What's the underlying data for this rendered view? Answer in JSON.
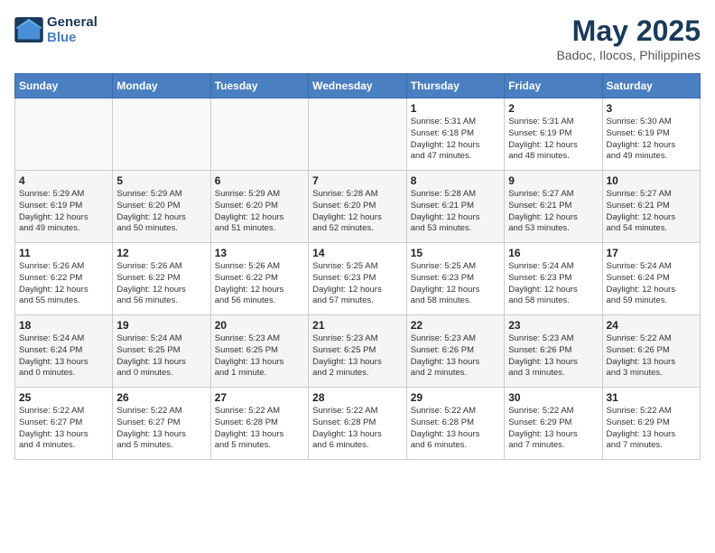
{
  "header": {
    "logo_line1": "General",
    "logo_line2": "Blue",
    "month": "May 2025",
    "location": "Badoc, Ilocos, Philippines"
  },
  "weekdays": [
    "Sunday",
    "Monday",
    "Tuesday",
    "Wednesday",
    "Thursday",
    "Friday",
    "Saturday"
  ],
  "weeks": [
    [
      {
        "day": "",
        "info": ""
      },
      {
        "day": "",
        "info": ""
      },
      {
        "day": "",
        "info": ""
      },
      {
        "day": "",
        "info": ""
      },
      {
        "day": "1",
        "info": "Sunrise: 5:31 AM\nSunset: 6:18 PM\nDaylight: 12 hours\nand 47 minutes."
      },
      {
        "day": "2",
        "info": "Sunrise: 5:31 AM\nSunset: 6:19 PM\nDaylight: 12 hours\nand 48 minutes."
      },
      {
        "day": "3",
        "info": "Sunrise: 5:30 AM\nSunset: 6:19 PM\nDaylight: 12 hours\nand 49 minutes."
      }
    ],
    [
      {
        "day": "4",
        "info": "Sunrise: 5:29 AM\nSunset: 6:19 PM\nDaylight: 12 hours\nand 49 minutes."
      },
      {
        "day": "5",
        "info": "Sunrise: 5:29 AM\nSunset: 6:20 PM\nDaylight: 12 hours\nand 50 minutes."
      },
      {
        "day": "6",
        "info": "Sunrise: 5:29 AM\nSunset: 6:20 PM\nDaylight: 12 hours\nand 51 minutes."
      },
      {
        "day": "7",
        "info": "Sunrise: 5:28 AM\nSunset: 6:20 PM\nDaylight: 12 hours\nand 52 minutes."
      },
      {
        "day": "8",
        "info": "Sunrise: 5:28 AM\nSunset: 6:21 PM\nDaylight: 12 hours\nand 53 minutes."
      },
      {
        "day": "9",
        "info": "Sunrise: 5:27 AM\nSunset: 6:21 PM\nDaylight: 12 hours\nand 53 minutes."
      },
      {
        "day": "10",
        "info": "Sunrise: 5:27 AM\nSunset: 6:21 PM\nDaylight: 12 hours\nand 54 minutes."
      }
    ],
    [
      {
        "day": "11",
        "info": "Sunrise: 5:26 AM\nSunset: 6:22 PM\nDaylight: 12 hours\nand 55 minutes."
      },
      {
        "day": "12",
        "info": "Sunrise: 5:26 AM\nSunset: 6:22 PM\nDaylight: 12 hours\nand 56 minutes."
      },
      {
        "day": "13",
        "info": "Sunrise: 5:26 AM\nSunset: 6:22 PM\nDaylight: 12 hours\nand 56 minutes."
      },
      {
        "day": "14",
        "info": "Sunrise: 5:25 AM\nSunset: 6:23 PM\nDaylight: 12 hours\nand 57 minutes."
      },
      {
        "day": "15",
        "info": "Sunrise: 5:25 AM\nSunset: 6:23 PM\nDaylight: 12 hours\nand 58 minutes."
      },
      {
        "day": "16",
        "info": "Sunrise: 5:24 AM\nSunset: 6:23 PM\nDaylight: 12 hours\nand 58 minutes."
      },
      {
        "day": "17",
        "info": "Sunrise: 5:24 AM\nSunset: 6:24 PM\nDaylight: 12 hours\nand 59 minutes."
      }
    ],
    [
      {
        "day": "18",
        "info": "Sunrise: 5:24 AM\nSunset: 6:24 PM\nDaylight: 13 hours\nand 0 minutes."
      },
      {
        "day": "19",
        "info": "Sunrise: 5:24 AM\nSunset: 6:25 PM\nDaylight: 13 hours\nand 0 minutes."
      },
      {
        "day": "20",
        "info": "Sunrise: 5:23 AM\nSunset: 6:25 PM\nDaylight: 13 hours\nand 1 minute."
      },
      {
        "day": "21",
        "info": "Sunrise: 5:23 AM\nSunset: 6:25 PM\nDaylight: 13 hours\nand 2 minutes."
      },
      {
        "day": "22",
        "info": "Sunrise: 5:23 AM\nSunset: 6:26 PM\nDaylight: 13 hours\nand 2 minutes."
      },
      {
        "day": "23",
        "info": "Sunrise: 5:23 AM\nSunset: 6:26 PM\nDaylight: 13 hours\nand 3 minutes."
      },
      {
        "day": "24",
        "info": "Sunrise: 5:22 AM\nSunset: 6:26 PM\nDaylight: 13 hours\nand 3 minutes."
      }
    ],
    [
      {
        "day": "25",
        "info": "Sunrise: 5:22 AM\nSunset: 6:27 PM\nDaylight: 13 hours\nand 4 minutes."
      },
      {
        "day": "26",
        "info": "Sunrise: 5:22 AM\nSunset: 6:27 PM\nDaylight: 13 hours\nand 5 minutes."
      },
      {
        "day": "27",
        "info": "Sunrise: 5:22 AM\nSunset: 6:28 PM\nDaylight: 13 hours\nand 5 minutes."
      },
      {
        "day": "28",
        "info": "Sunrise: 5:22 AM\nSunset: 6:28 PM\nDaylight: 13 hours\nand 6 minutes."
      },
      {
        "day": "29",
        "info": "Sunrise: 5:22 AM\nSunset: 6:28 PM\nDaylight: 13 hours\nand 6 minutes."
      },
      {
        "day": "30",
        "info": "Sunrise: 5:22 AM\nSunset: 6:29 PM\nDaylight: 13 hours\nand 7 minutes."
      },
      {
        "day": "31",
        "info": "Sunrise: 5:22 AM\nSunset: 6:29 PM\nDaylight: 13 hours\nand 7 minutes."
      }
    ]
  ]
}
